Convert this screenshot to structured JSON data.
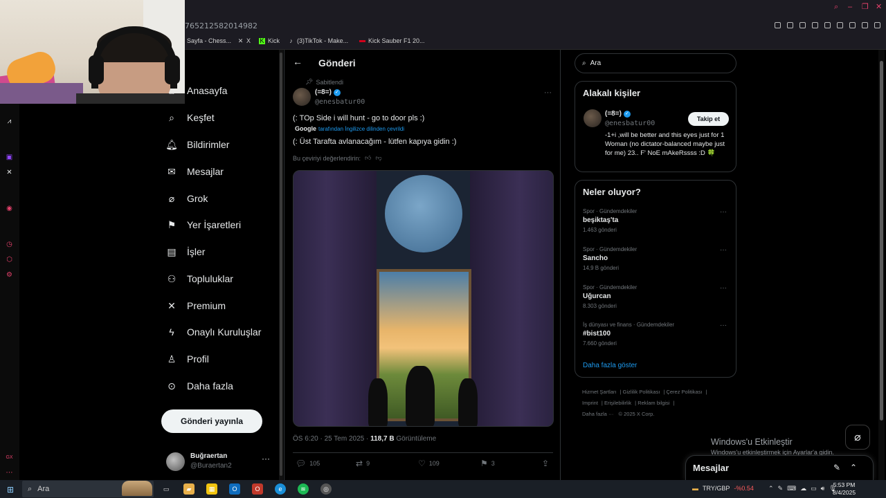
{
  "browser": {
    "url_fragment": "765212582014982",
    "bookmarks": [
      {
        "icon": "chess-icon",
        "label": "Sayfa - Chess..."
      },
      {
        "icon": "x-icon",
        "label": "X"
      },
      {
        "icon": "kick-icon",
        "label": "Kick"
      },
      {
        "icon": "tiktok-icon",
        "label": "(3)TikTok - Make..."
      },
      {
        "icon": "f1-icon",
        "label": "Kick Sauber F1 20..."
      }
    ]
  },
  "nav": {
    "items": [
      {
        "icon": "home-icon",
        "label": "Anasayfa"
      },
      {
        "icon": "search-icon",
        "label": "Keşfet"
      },
      {
        "icon": "bell-icon",
        "label": "Bildirimler"
      },
      {
        "icon": "mail-icon",
        "label": "Mesajlar"
      },
      {
        "icon": "grok-icon",
        "label": "Grok"
      },
      {
        "icon": "bookmark-icon",
        "label": "Yer İşaretleri"
      },
      {
        "icon": "briefcase-icon",
        "label": "İşler"
      },
      {
        "icon": "communities-icon",
        "label": "Topluluklar"
      },
      {
        "icon": "x-logo-icon",
        "label": "Premium"
      },
      {
        "icon": "lightning-icon",
        "label": "Onaylı Kuruluşlar"
      },
      {
        "icon": "profile-icon",
        "label": "Profil"
      },
      {
        "icon": "more-circle-icon",
        "label": "Daha fazla"
      }
    ],
    "post_button": "Gönderi yayınla",
    "account": {
      "name": "Buğraertan",
      "handle": "@Buraertan2"
    }
  },
  "main": {
    "title": "Gönderi",
    "pinned_label": "Sabitlendi",
    "author_name": "(=8=)",
    "author_handle": "@enesbatur00",
    "text": "(: TOp Side i will hunt - go to door pls :)",
    "translated_by_brand": "Google",
    "translated_note": "tarafından İngilizce dilinden çevrildi",
    "translation": "(: Üst Tarafta avlanacağım - lütfen kapıya gidin :)",
    "rate_prompt": "Bu çeviriyi değerlendirin:",
    "timestamp": "ÖS 6:20 · 25 Tem 2025 · ",
    "views_count": "118,7 B",
    "views_label": "Görüntüleme",
    "actions": {
      "replies": "105",
      "reposts": "9",
      "likes": "109",
      "bookmarks": "3"
    }
  },
  "right": {
    "search_placeholder": "Ara",
    "related_title": "Alakalı kişiler",
    "related_person": {
      "name": "(=8=)",
      "handle": "@enesbatur00",
      "follow_label": "Takip et",
      "bio": "-1+i ,will be better and this eyes just for 1 Woman (no dictator-balanced maybe just for me) 23.. F' NoE mAkeRssss :D 🍀"
    },
    "trends_title": "Neler oluyor?",
    "trends": [
      {
        "category": "Spor · Gündemdekiler",
        "name": "beşiktaş'ta",
        "count": "1.463 gönderi"
      },
      {
        "category": "Spor · Gündemdekiler",
        "name": "Sancho",
        "count": "14,9 B gönderi"
      },
      {
        "category": "Spor · Gündemdekiler",
        "name": "Uğurcan",
        "count": "8.303 gönderi"
      },
      {
        "category": "İş dünyası ve finans · Gündemdekiler",
        "name": "#bist100",
        "count": "7.660 gönderi"
      }
    ],
    "show_more": "Daha fazla göster",
    "footer": [
      "Hizmet Şartları",
      "Gizlilik Politikası",
      "Çerez Politikası",
      "Imprint",
      "Erişilebilirlik",
      "Reklam bilgisi",
      "Daha fazla ···",
      "© 2025 X Corp."
    ]
  },
  "overlay": {
    "activate_title": "Windows'u Etkinleştir",
    "activate_sub": "Windows'u etkinleştirmek için Ayarlar'a gidin.",
    "messages_title": "Mesajlar"
  },
  "taskbar": {
    "search_placeholder": "Ara",
    "ticker_pair": "TRY/GBP",
    "ticker_change": "-%0.54",
    "time": "5:53 PM",
    "date": "8/4/2025"
  },
  "colors": {
    "accent": "#1d9bf0",
    "background": "#000000",
    "text": "#e7e9ea",
    "muted": "#71767b"
  }
}
